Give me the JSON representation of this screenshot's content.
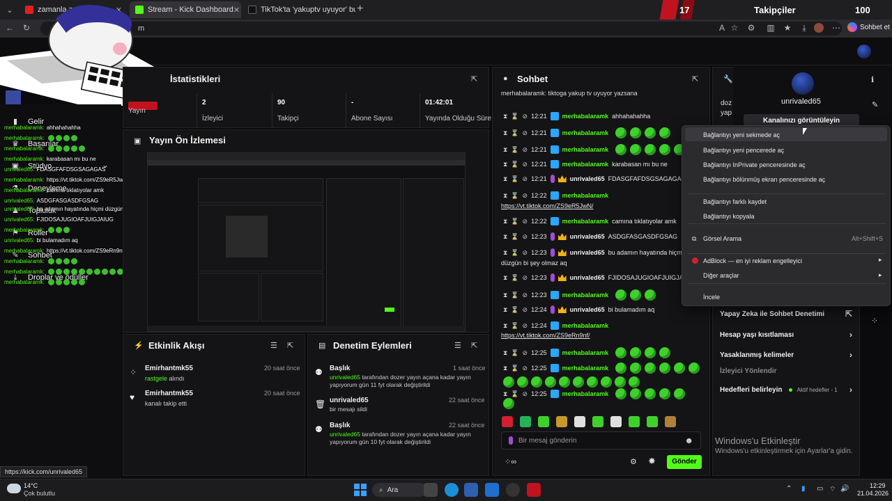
{
  "browser": {
    "tabs": [
      {
        "title": "zamanla zama",
        "color": "#e02020"
      },
      {
        "title": "Stream - Kick Dashboard",
        "color": "#53fc18"
      },
      {
        "title": "TikTok'ta 'yakuptv uyuyor' bulabili",
        "color": "#111111"
      }
    ],
    "address": "m",
    "profile_button": "Sohbet et",
    "banner_number": "17",
    "banner_label": "Takipçiler",
    "banner_count": "100"
  },
  "dashboard": {
    "stats_title": "İstatistikleri",
    "stats": [
      {
        "value": "",
        "label": "Yayın"
      },
      {
        "value": "2",
        "label": "İzleyici"
      },
      {
        "value": "90",
        "label": "Takipçi"
      },
      {
        "value": "-",
        "label": "Abone Sayısı"
      },
      {
        "value": "01:42:01",
        "label": "Yayında Olduğu Süre"
      }
    ],
    "preview_title": "Yayın Ön İzlemesi",
    "sidebar": [
      {
        "label": "Gelir",
        "icon": "chart-icon"
      },
      {
        "label": "Başarılar",
        "icon": "trophy-icon"
      },
      {
        "label": "Stüdyo",
        "icon": "studio-icon"
      },
      {
        "label": "Deneyleme",
        "icon": "flask-icon"
      },
      {
        "label": "Topluluk",
        "icon": "community-icon"
      },
      {
        "label": "Roller",
        "icon": "roles-icon"
      },
      {
        "label": "Sohbet",
        "icon": "chat-icon"
      },
      {
        "label": "Droplar ve ödüller",
        "icon": "drops-icon"
      }
    ],
    "activity": {
      "title": "Etkinlik Akışı",
      "items": [
        {
          "user": "Emirhantmk55",
          "time": "20 saat önce",
          "prefix": "",
          "accent": "rastgele",
          "text": " alındı"
        },
        {
          "user": "Emirhantmk55",
          "time": "20 saat önce",
          "prefix": "",
          "accent": "",
          "text": "kanalı takip etti"
        }
      ]
    },
    "mod_actions": {
      "title": "Denetim Eylemleri",
      "items": [
        {
          "title": "Başlık",
          "time": "1 saat önce",
          "accent": "unrivaled65",
          "text": " tarafından dozer yayın açana kadar yayın yapıyorum gün 11 fyt olarak değiştirildi"
        },
        {
          "title": "unrivaled65",
          "time": "22 saat önce",
          "accent": "",
          "text": "bir mesajı sildi"
        },
        {
          "title": "Başlık",
          "time": "22 saat önce",
          "accent": "unrivaled65",
          "text": " tarafından dozer yayın açana kadar yayın yapıyorum gün 10 fyt olarak değiştirildi"
        }
      ]
    }
  },
  "overlay_chat": [
    {
      "user": "merhabalaramk:",
      "text": "ahhahahahha",
      "emotes": 0
    },
    {
      "user": "merhabalaramk:",
      "text": "",
      "emotes": 4
    },
    {
      "user": "merhabalaramk:",
      "text": "",
      "emotes": 5
    },
    {
      "user": "merhabalaramk:",
      "text": "karabasan mı bu ne",
      "emotes": 0
    },
    {
      "user": "unrivaled65:",
      "text": "FDASGFAFDSGSAGAGAS",
      "emotes": 0
    },
    {
      "user": "merhabalaramk:",
      "text": "https://vt.tiktok.com/ZS9eR5JwN/",
      "emotes": 0
    },
    {
      "user": "merhabalaramk:",
      "text": "camına tıklatıyolar amk",
      "emotes": 0
    },
    {
      "user": "unrivaled65:",
      "text": "ASDGFASGASDFGSAG",
      "emotes": 0
    },
    {
      "user": "unrivaled65:",
      "text": "bu adamın hayatında hiçmi düzgün bi sey olmaz aq",
      "emotes": 0
    },
    {
      "user": "unrivaled65:",
      "text": "FJIDOSAJUGIOAFJUIGJAIUG",
      "emotes": 0
    },
    {
      "user": "merhabalaramk:",
      "text": "",
      "emotes": 3
    },
    {
      "user": "unrivaled65:",
      "text": "bi bulamadım aq",
      "emotes": 0
    },
    {
      "user": "merhabalaramk:",
      "text": "https://vt.tiktok.com/ZS9eRn9nf/",
      "emotes": 0
    },
    {
      "user": "merhabalaramk:",
      "text": "",
      "emotes": 4
    },
    {
      "user": "merhabalaramk:",
      "text": "",
      "emotes": 14
    },
    {
      "user": "merhabalaramk:",
      "text": "",
      "emotes": 5
    }
  ],
  "chat": {
    "title": "Sohbet",
    "top_text": "merhabalaramk: tiktoga yakup tv uyuyor yazsana",
    "messages": [
      {
        "time": "12:21",
        "user": "merhabalaramk",
        "role": "green",
        "text": "ahhahahahha",
        "emotes": 0
      },
      {
        "time": "12:21",
        "user": "merhabalaramk",
        "role": "green",
        "text": "",
        "emotes": 4
      },
      {
        "time": "12:21",
        "user": "merhabalaramk",
        "role": "green",
        "text": "",
        "emotes": 5
      },
      {
        "time": "12:21",
        "user": "merhabalaramk",
        "role": "green",
        "text": "karabasan mı bu ne",
        "emotes": 0
      },
      {
        "time": "12:21",
        "user": "unrivaled65",
        "role": "owner",
        "text": "FDASGFAFDSGSAGAGAS",
        "emotes": 0
      },
      {
        "time": "12:22",
        "user": "merhabalaramk",
        "role": "green",
        "text": "",
        "emotes": 0
      },
      {
        "time": "12:22",
        "user": "merhabalaramk",
        "role": "green",
        "text": "camına tıklatıyolar amk",
        "emotes": 0
      },
      {
        "time": "12:23",
        "user": "unrivaled65",
        "role": "owner",
        "text": "ASDGFASGASDFGSAG",
        "emotes": 0
      },
      {
        "time": "12:23",
        "user": "unrivaled65",
        "role": "owner",
        "text": "bu adamın hayatında hiçmi",
        "emotes": 0
      },
      {
        "time": "12:23",
        "user": "unrivaled65",
        "role": "owner",
        "text": "FJIDOSAJUGIOAFJUIGJA",
        "emotes": 0
      },
      {
        "time": "12:23",
        "user": "merhabalaramk",
        "role": "green",
        "text": "",
        "emotes": 3
      },
      {
        "time": "12:24",
        "user": "unrivaled65",
        "role": "owner",
        "text": "bi bulamadım aq",
        "emotes": 0
      },
      {
        "time": "12:24",
        "user": "merhabalaramk",
        "role": "green",
        "text": "",
        "emotes": 0
      },
      {
        "time": "12:25",
        "user": "merhabalaramk",
        "role": "green",
        "text": "",
        "emotes": 4
      },
      {
        "time": "12:25",
        "user": "merhabalaramk",
        "role": "green",
        "text": "",
        "emotes": 6
      },
      {
        "time": "12:25",
        "user": "merhabalaramk",
        "role": "green",
        "text": "",
        "emotes": 5
      }
    ],
    "link1": "https://vt.tiktok.com/ZS9eR5JwN/",
    "link2": "https://vt.tiktok.com/ZS9eRn9nf/",
    "wrap1": "düzgün bi şey olmaz aq",
    "input_placeholder": "Bir mesaj gönderin",
    "send_label": "Gönder"
  },
  "right_panel": {
    "top_text": "doz yap",
    "username": "unrivaled65",
    "view_channel": "Kanalınızı görüntüleyin",
    "items": [
      {
        "label": "Yapay Zeka ile Sohbet Denetimi",
        "extra": ""
      },
      {
        "label": "Hesap yaşı kısıtlaması",
        "extra": ""
      },
      {
        "label": "Yasaklanmış kelimeler",
        "extra": ""
      },
      {
        "label": "İzleyici Yönlendir",
        "extra": ""
      },
      {
        "label": "Hedefleri belirleyin",
        "extra": "Aktif hedefler - 1"
      }
    ]
  },
  "context_menu": {
    "items": [
      "Bağlantıyı yeni sekmede aç",
      "Bağlantıyı yeni pencerede aç",
      "Bağlantıyı InPrivate penceresinde aç",
      "Bağlantıyı bölünmüş ekran penceresinde aç",
      "Bağlantıyı farklı kaydet",
      "Bağlantıyı kopyala",
      "Görsel Arama",
      "AdBlock — en iyi reklam engelleyici",
      "Diğer araçlar",
      "İncele"
    ],
    "shortcut": "Alt+Shift+S"
  },
  "windows_watermark": {
    "title": "Windows'u Etkinleştir",
    "subtitle": "Windows'u etkinleştirmek için Ayarlar'a gidin."
  },
  "status_url": "https://kick.com/unrivaled65",
  "taskbar": {
    "weather_temp": "14°C",
    "weather_desc": "Çok bulutlu",
    "search": "Ara",
    "time": "12:29",
    "date": "21.04.2026"
  }
}
